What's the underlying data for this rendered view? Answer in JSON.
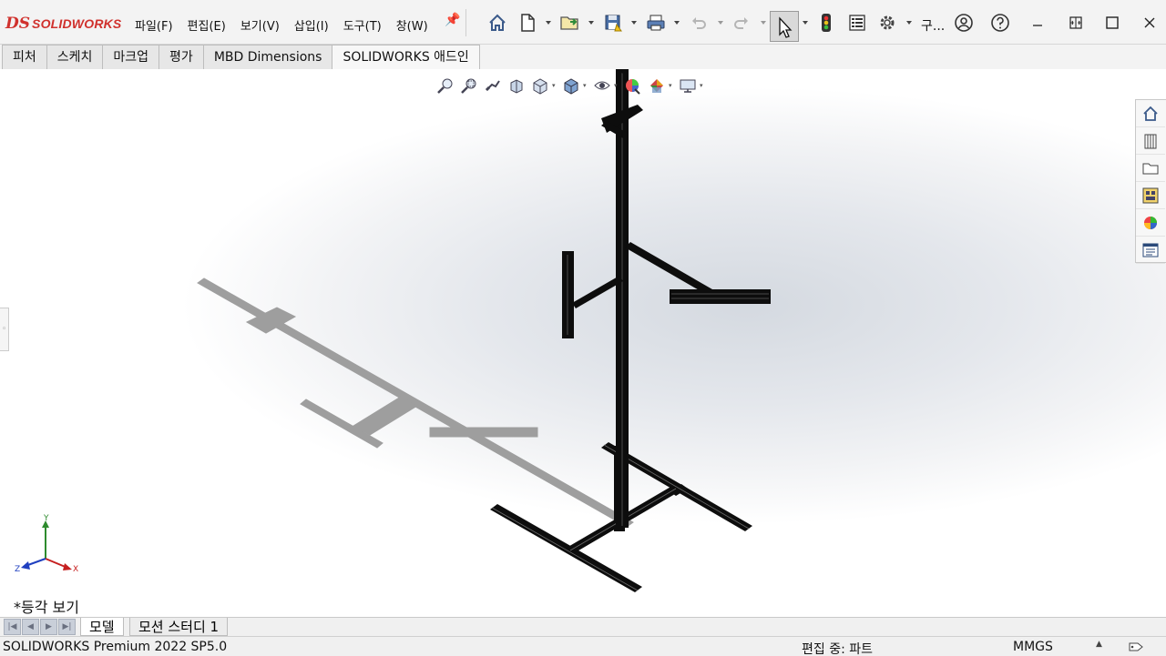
{
  "app": {
    "logo_mark": "DS",
    "logo_text": "SOLIDWORKS"
  },
  "menu": [
    {
      "label": "파일(F)"
    },
    {
      "label": "편집(E)"
    },
    {
      "label": "보기(V)"
    },
    {
      "label": "삽입(I)"
    },
    {
      "label": "도구(T)"
    },
    {
      "label": "창(W)"
    }
  ],
  "toolbar": {
    "search_label": "구...",
    "icons": [
      "home-icon",
      "new-document-icon",
      "open-icon",
      "save-icon",
      "print-icon",
      "undo-icon",
      "redo-icon",
      "select-icon",
      "rebuild-icon",
      "file-properties-icon",
      "options-icon",
      "account-icon",
      "help-icon"
    ]
  },
  "window_controls": [
    "minimize-icon",
    "restore-icon",
    "maximize-icon",
    "close-icon"
  ],
  "command_tabs": [
    {
      "label": "피처",
      "active": false
    },
    {
      "label": "스케치",
      "active": false
    },
    {
      "label": "마크업",
      "active": false
    },
    {
      "label": "평가",
      "active": false
    },
    {
      "label": "MBD Dimensions",
      "active": false
    },
    {
      "label": "SOLIDWORKS 애드인",
      "active": true
    }
  ],
  "heads_up_toolbar": [
    "zoom-to-fit-icon",
    "zoom-to-area-icon",
    "previous-view-icon",
    "section-view-icon",
    "view-orientation-icon",
    "display-style-icon",
    "hide-show-icon",
    "edit-appearance-icon",
    "apply-scene-icon",
    "view-settings-icon"
  ],
  "task_pane": [
    "home-icon",
    "design-library-icon",
    "file-explorer-icon",
    "view-palette-icon",
    "appearances-icon",
    "custom-properties-icon"
  ],
  "triad": {
    "x": "X",
    "y": "Y",
    "z": "Z"
  },
  "view_label": "*등각 보기",
  "model_tabs": [
    {
      "label": "모델",
      "active": true
    },
    {
      "label": "모션 스터디 1",
      "active": false
    }
  ],
  "status": {
    "app_version": "SOLIDWORKS Premium 2022 SP5.0",
    "mode": "편집 중: 파트",
    "units": "MMGS"
  },
  "colors": {
    "brand_red": "#d0312d",
    "model_black": "#111111",
    "shadow_gray": "#9a9a9a"
  }
}
